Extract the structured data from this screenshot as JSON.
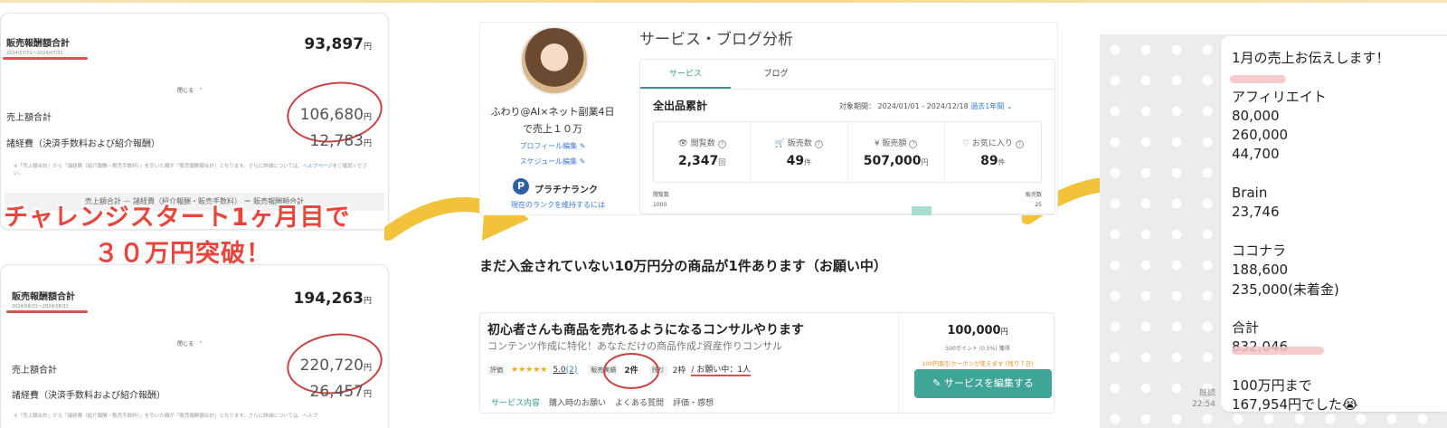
{
  "panel1": {
    "title": "販売報酬額合計",
    "date": "2024/07/01～2024/07/31",
    "total": "93,897",
    "yen": "円",
    "close_label": "閉じる",
    "sales_label": "売上額合計",
    "sales_value": "106,680",
    "fees_label": "諸経費（決済手数料および紹介報酬）",
    "fees_value": "12,783",
    "note": "※「売上額合計」から「諸経費（紹介報酬・販売手数料）」を引いた額が「販売報酬額合計」となります。さらに詳細については、",
    "note_link": "ヘルプページ",
    "note_end": "をご確認ください。",
    "formula": "売上額合計 － 諸経費（紹介報酬・販売手数料） ＝ 販売報酬額合計"
  },
  "headline": {
    "line1": "チャレンジスタート1ヶ月目で",
    "line2": "３０万円突破！"
  },
  "panel2": {
    "title": "販売報酬額合計",
    "date": "2024/08/01～2024/08/31",
    "total": "194,263",
    "yen": "円",
    "close_label": "閉じる",
    "sales_label": "売上額合計",
    "sales_value": "220,720",
    "fees_label": "諸経費（決済手数料および紹介報酬）",
    "fees_value": "26,457",
    "note": "※「売上額合計」から「諸経費（紹介報酬・販売手数料）」を引いた額が「販売報酬額合計」となります。さらに詳細については、ヘルプ"
  },
  "profile": {
    "name_line1": "ふわり@AI×ネット副業4日",
    "name_line2": "で売上１０万",
    "edit_profile": "プロフィール編集",
    "edit_schedule": "スケジュール編集",
    "rank_badge": "P",
    "rank": "プラチナランク",
    "rank_link": "現在のランクを維持するには"
  },
  "analysis": {
    "title": "サービス・ブログ分析",
    "tabs": [
      "サービス",
      "ブログ"
    ],
    "section": "全出品累計",
    "period_label": "対象期間：",
    "period": "2024/01/01 - 2024/12/18",
    "period_select": "過去1年間",
    "stats": [
      {
        "label": "閲覧数",
        "value": "2,347",
        "unit": "回",
        "icon": "eye-icon",
        "glyph": "👁"
      },
      {
        "label": "販売数",
        "value": "49",
        "unit": "件",
        "icon": "cart-icon",
        "glyph": "🛒"
      },
      {
        "label": "販売額",
        "value": "507,000",
        "unit": "円",
        "icon": "yen-coin-icon",
        "glyph": "¥"
      },
      {
        "label": "お気に入り",
        "value": "89",
        "unit": "件",
        "icon": "heart-icon",
        "glyph": "♡"
      }
    ],
    "help_glyph": "?",
    "chart_left_label": "閲覧数",
    "chart_left_tick": "1000",
    "chart_right_label": "販売数",
    "chart_right_tick": "25"
  },
  "mid_caption": "まだ入金されていない10万円分の商品が1件あります（お願い中）",
  "service_card": {
    "title": "初心者さんも商品を売れるようになるコンサルやります",
    "subtitle": "コンテンツ作成に特化！あなただけの商品作成♪資産作りコンサル",
    "rating_label": "評価",
    "stars": "★★★★★",
    "rating": "5.0",
    "rating_count": "(2)",
    "sales_label": "販売実績",
    "sales_count": "2件",
    "remain_label": "残り",
    "remain_count": "2枠",
    "pending": "/ お願い中：1人",
    "tabs": [
      "サービス内容",
      "購入時のお願い",
      "よくある質問",
      "評価・感想"
    ],
    "price": "100,000",
    "price_unit": "円",
    "points": "500ポイント (0.5%) 獲得",
    "coupon": "100円割引クーポンが使えます (残り７日)",
    "edit_button": "サービスを編集する"
  },
  "chat": {
    "message": "1月の売上お伝えします！\n\nアフィリエイト\n80,000\n260,000\n44,700\n\nBrain\n23,746\n\nココナラ\n188,600\n235,000(未着金)\n\n合計\n832,046\n\n100万円まで\n167,954円でした😭",
    "read_label": "既読",
    "time": "22:54"
  },
  "colors": {
    "accent_teal": "#2a9d8f",
    "red": "#e8453c",
    "arrow": "#f2c23a"
  }
}
